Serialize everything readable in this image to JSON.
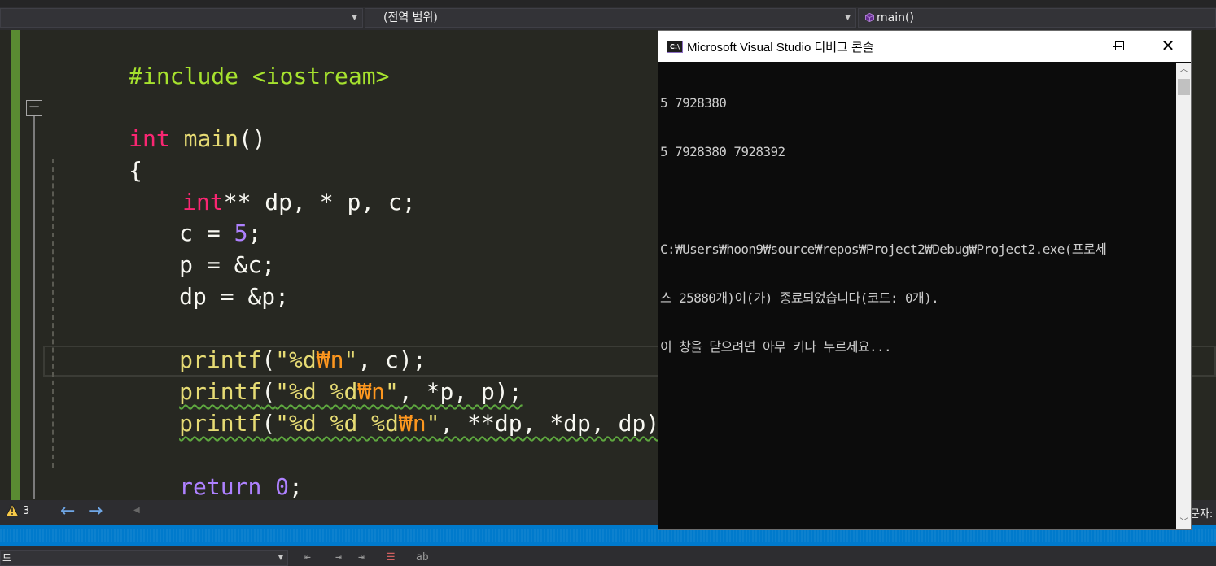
{
  "navbar": {
    "scope_label": "(전역 범위)",
    "member_label": "main()"
  },
  "editor": {
    "lines": {
      "l1_kw": "#include",
      "l1_rest": " <iostream>",
      "l2_kw": "int",
      "l2_fn": "main",
      "l2_rest": "()",
      "l3": "{",
      "l4_kw": "int",
      "l4_rest": "** dp, * p, c;",
      "l5_pre": "c = ",
      "l5_num": "5",
      "l5_post": ";",
      "l6": "p = &c;",
      "l7": "dp = &p;",
      "l8_fn": "printf",
      "l8_open": "(",
      "l8_str1": "\"%d",
      "l8_esc": "₩n",
      "l8_str2": "\"",
      "l8_rest": ", c);",
      "l9_fn": "printf",
      "l9_open": "(",
      "l9_str1": "\"%d %d",
      "l9_esc": "₩n",
      "l9_str2": "\"",
      "l9_rest": ", *p, p);",
      "l10_fn": "printf",
      "l10_open": "(",
      "l10_str1": "\"%d %d %d",
      "l10_esc": "₩n",
      "l10_str2": "\"",
      "l10_rest": ", **dp, *dp, dp);",
      "l11_kw": "return",
      "l11_sp": " ",
      "l11_num": "0",
      "l11_post": ";",
      "l12": "}"
    },
    "fold_symbol": "−"
  },
  "editor_status": {
    "warning_count": "3",
    "back_arrow": "←",
    "forward_arrow": "→",
    "scroll_left_arrow": "◀",
    "right_label": "문자:"
  },
  "bottom_toolbar": {
    "combo_text": "드"
  },
  "console": {
    "icon_text": "C:\\",
    "title": "Microsoft Visual Studio 디버그 콘솔",
    "close_glyph": "✕",
    "output": [
      "5 7928380",
      "5 7928380 7928392",
      "",
      "C:₩Users₩hoon9₩source₩repos₩Project2₩Debug₩Project2.exe(프로세",
      "스 25880개)이(가) 종료되었습니다(코드: 0개).",
      "이 창을 닫으려면 아무 키나 누르세요..."
    ]
  },
  "colors": {
    "editor_bg": "#272822",
    "keyword": "#f92672",
    "preprocessor": "#a6e22e",
    "function": "#e6db74",
    "number": "#ae81ff",
    "escape": "#fd971f",
    "status_blue": "#007acc",
    "console_bg": "#0c0c0c"
  }
}
